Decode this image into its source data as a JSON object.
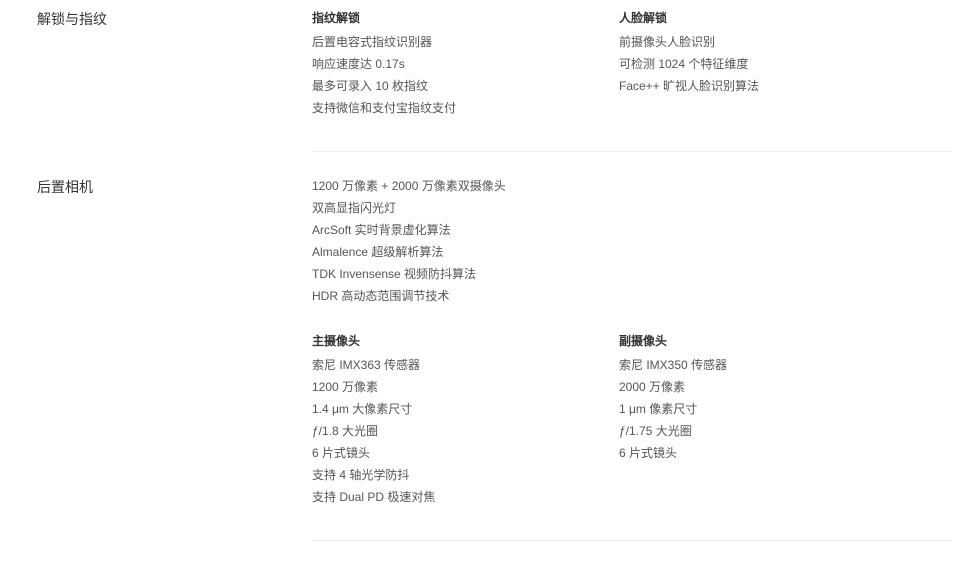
{
  "unlock": {
    "title": "解锁与指纹",
    "fingerprint": {
      "heading": "指纹解锁",
      "lines": [
        "后置电容式指纹识别器",
        "响应速度达 0.17s",
        "最多可录入 10 枚指纹",
        "支持微信和支付宝指纹支付"
      ]
    },
    "face": {
      "heading": "人脸解锁",
      "lines": [
        "前摄像头人脸识别",
        "可检测 1024 个特征维度",
        "Face++ 旷视人脸识别算法"
      ]
    }
  },
  "rear_camera": {
    "title": "后置相机",
    "features": [
      "1200 万像素 + 2000 万像素双摄像头",
      "双高显指闪光灯",
      "ArcSoft 实时背景虚化算法",
      "Almalence 超级解析算法",
      "TDK Invensense 视频防抖算法",
      "HDR 高动态范围调节技术"
    ],
    "main": {
      "heading": "主摄像头",
      "lines": [
        "索尼 IMX363 传感器",
        "1200 万像素",
        "1.4 μm 大像素尺寸",
        "ƒ/1.8 大光圈",
        "6 片式镜头",
        "支持 4 轴光学防抖",
        "支持 Dual PD 极速对焦"
      ]
    },
    "sub": {
      "heading": "副摄像头",
      "lines": [
        "索尼 IMX350 传感器",
        "2000 万像素",
        "1 μm 像素尺寸",
        "ƒ/1.75 大光圈",
        "6 片式镜头"
      ]
    }
  }
}
